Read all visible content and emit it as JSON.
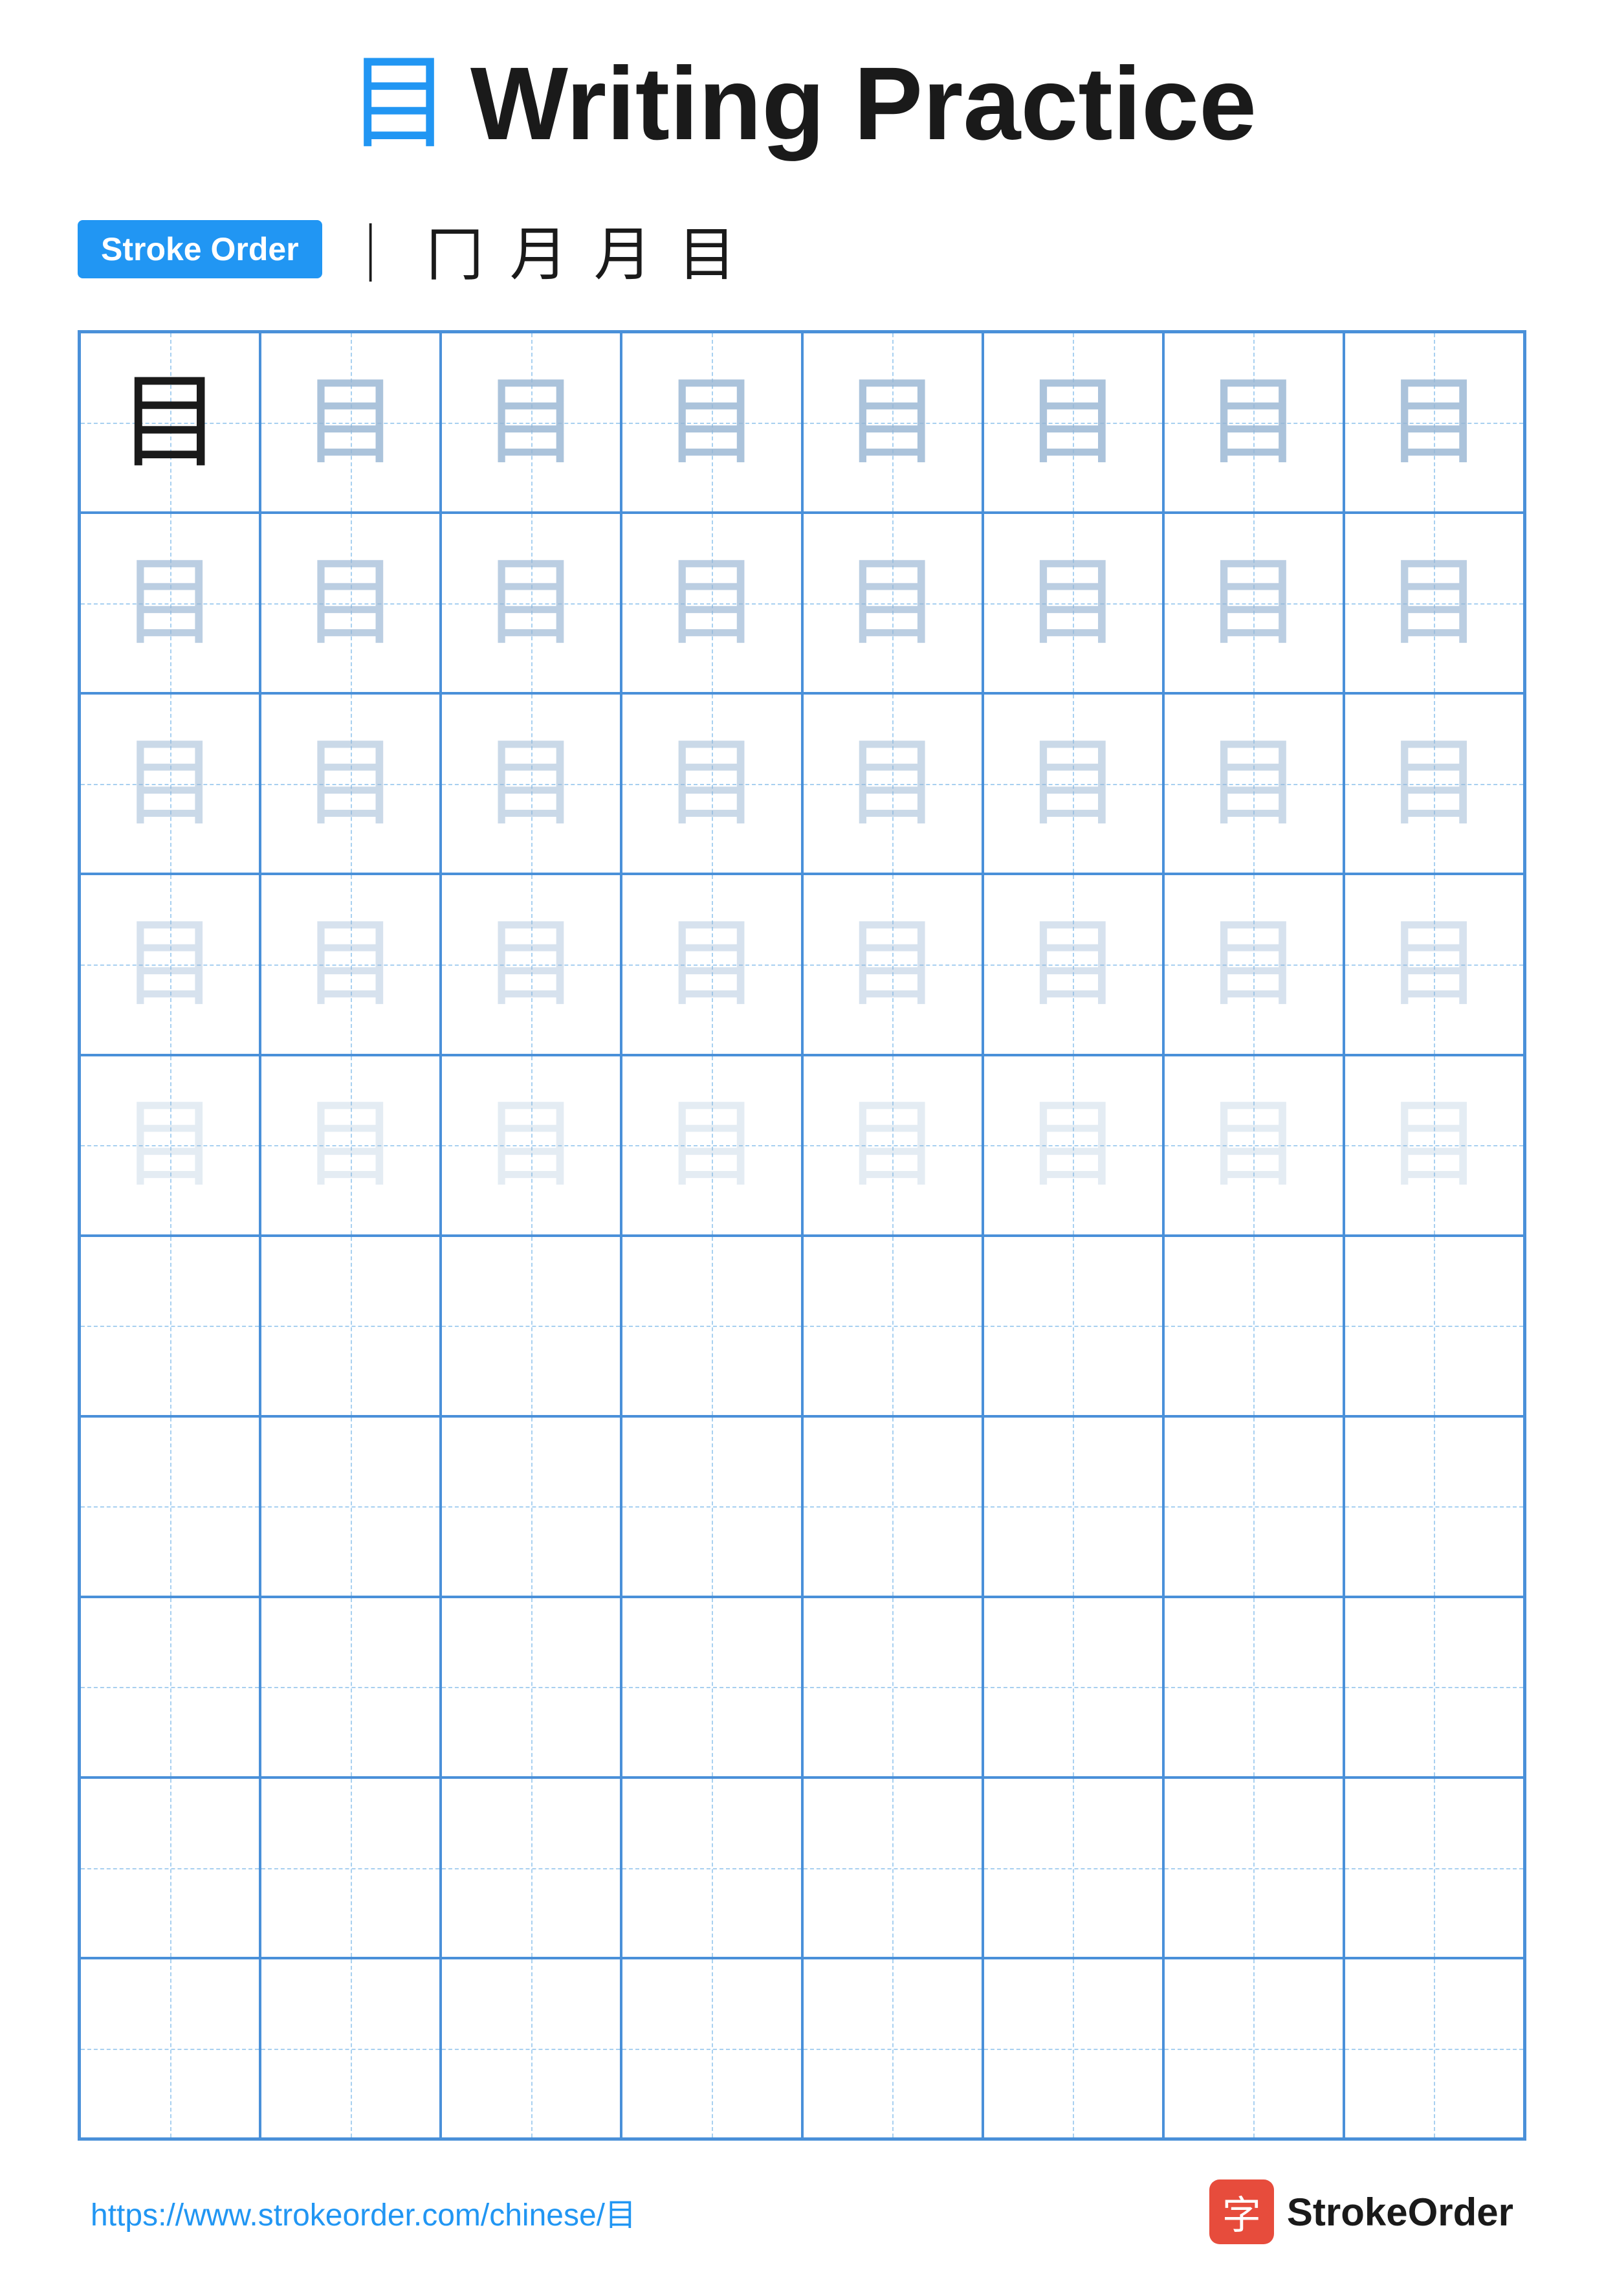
{
  "title": {
    "char": "目",
    "text": "Writing Practice"
  },
  "stroke_order": {
    "badge_label": "Stroke Order",
    "steps": [
      "｜",
      "冂",
      "月",
      "月",
      "目"
    ]
  },
  "grid": {
    "cols": 8,
    "rows": 10,
    "practice_char": "目",
    "row_types": [
      "model",
      "ghost1",
      "ghost2",
      "ghost3",
      "ghost4",
      "empty",
      "empty",
      "empty",
      "empty",
      "empty"
    ]
  },
  "footer": {
    "url": "https://www.strokeorder.com/chinese/目",
    "logo_char": "字",
    "logo_text": "StrokeOrder"
  }
}
